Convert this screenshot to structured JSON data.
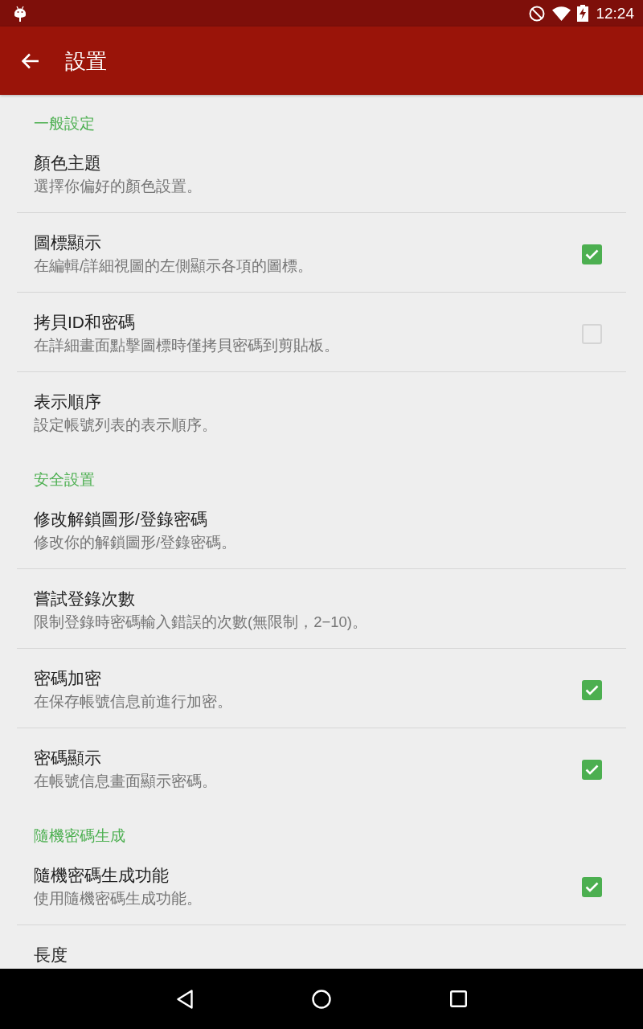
{
  "status_bar": {
    "time": "12:24"
  },
  "app_bar": {
    "title": "設置"
  },
  "sections": [
    {
      "header": "一般設定",
      "items": [
        {
          "kind": "plain",
          "title": "顏色主題",
          "summary": "選擇你偏好的顏色設置。"
        },
        {
          "kind": "checkbox",
          "title": "圖標顯示",
          "summary": "在編輯/詳細視圖的左側顯示各項的圖標。",
          "checked": true
        },
        {
          "kind": "checkbox",
          "title": "拷貝ID和密碼",
          "summary": "在詳細畫面點擊圖標時僅拷貝密碼到剪貼板。",
          "checked": false
        },
        {
          "kind": "plain",
          "title": "表示順序",
          "summary": "設定帳號列表的表示順序。"
        }
      ]
    },
    {
      "header": "安全設置",
      "items": [
        {
          "kind": "plain",
          "title": "修改解鎖圖形/登錄密碼",
          "summary": "修改你的解鎖圖形/登錄密碼。"
        },
        {
          "kind": "plain",
          "title": "嘗試登錄次數",
          "summary": "限制登錄時密碼輸入錯誤的次數(無限制，2−10)。"
        },
        {
          "kind": "checkbox",
          "title": "密碼加密",
          "summary": "在保存帳號信息前進行加密。",
          "checked": true
        },
        {
          "kind": "checkbox",
          "title": "密碼顯示",
          "summary": "在帳號信息畫面顯示密碼。",
          "checked": true
        }
      ]
    },
    {
      "header": "隨機密碼生成",
      "items": [
        {
          "kind": "checkbox",
          "title": "隨機密碼生成功能",
          "summary": "使用隨機密碼生成功能。",
          "checked": true
        },
        {
          "kind": "plain",
          "title": "長度"
        }
      ]
    }
  ]
}
